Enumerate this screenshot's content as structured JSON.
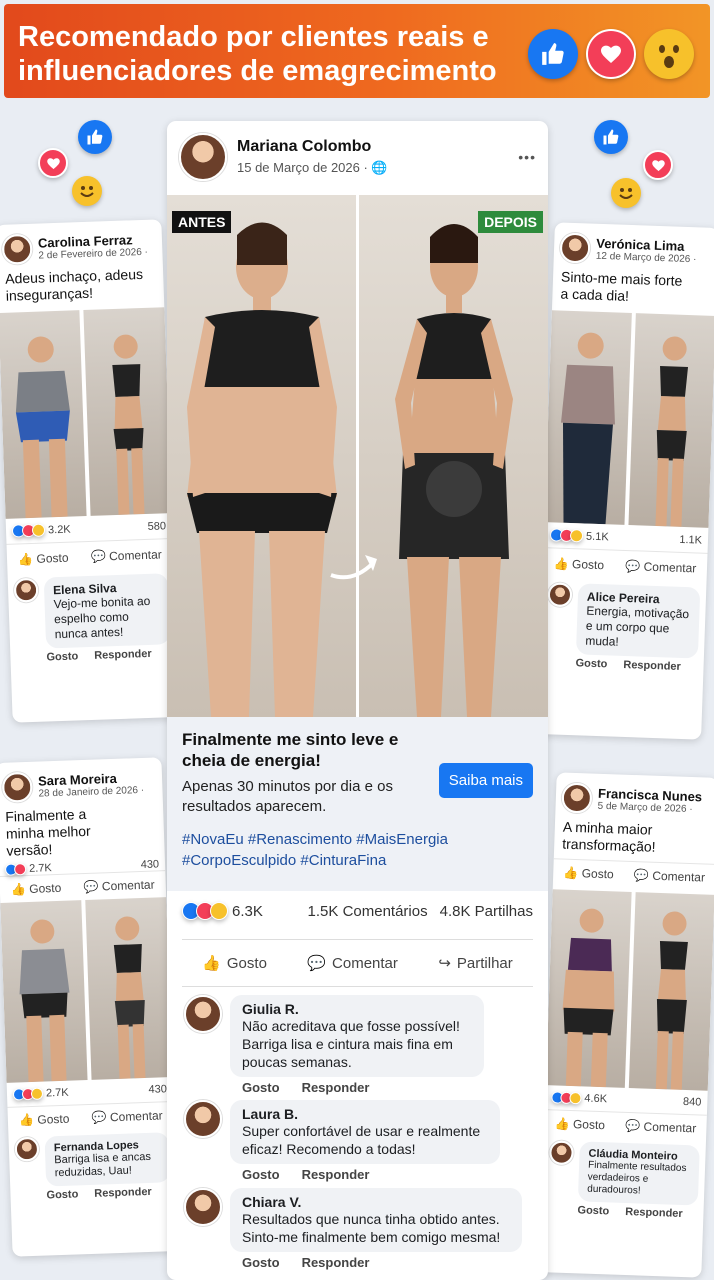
{
  "banner": {
    "title": "Recomendado por clientes reais e influenciadores de emagrecimento",
    "icons": [
      "like-icon",
      "heart-icon",
      "wow-icon"
    ]
  },
  "main_post": {
    "author": "Mariana Colombo",
    "date": "15 de Março de 2026 · ",
    "more": "•••",
    "before_label": "ANTES",
    "after_label": "DEPOIS",
    "headline": "Finalmente me sinto leve e cheia de energia!",
    "subtext": "Apenas 30 minutos por dia e os resultados aparecem.",
    "cta": "Saiba mais",
    "hashtags": "#NovaEu #Renascimento #MaisEnergia #CorpoEsculpido #CinturaFina",
    "reactions": "6.3K",
    "comments_count": "1.5K Comentários",
    "shares_count": "4.8K Partilhas",
    "actions": {
      "like": "Gosto",
      "comment": "Comentar",
      "share": "Partilhar"
    },
    "comments": [
      {
        "name": "Giulia R.",
        "text": "Não acreditava que fosse possível! Barriga lisa e cintura mais fina em poucas semanas.",
        "like": "Gosto",
        "reply": "Responder"
      },
      {
        "name": "Laura B.",
        "text": "Super confortável de usar e realmente eficaz! Recomendo a todas!",
        "like": "Gosto",
        "reply": "Responder"
      },
      {
        "name": "Chiara V.",
        "text": "Resultados que nunca tinha obtido antes. Sinto-me finalmente bem comigo mesma!",
        "like": "Gosto",
        "reply": "Responder"
      }
    ]
  },
  "side_posts": [
    {
      "author": "Carolina Ferraz",
      "date": "2 de Fevereiro de 2026 · ",
      "text": "Adeus inchaço, adeus inseguranças!",
      "reactions": "3.2K",
      "count": "580",
      "like": "Gosto",
      "comment": "Comentar",
      "comment_name": "Elena Silva",
      "comment_text": "Vejo-me bonita ao espelho como nunca antes!",
      "c_like": "Gosto",
      "c_reply": "Responder"
    },
    {
      "author": "Verónica Lima",
      "date": "12 de Março de 2026 · ",
      "text": "Sinto-me mais forte a cada dia!",
      "reactions": "5.1K",
      "count": "1.1K",
      "like": "Gosto",
      "comment": "Comentar",
      "comment_name": "Alice Pereira",
      "comment_text": "Energia, motivação e um corpo que muda!",
      "c_like": "Gosto",
      "c_reply": "Responder"
    },
    {
      "author": "Sara Moreira",
      "date": "28 de Janeiro de 2026 · ",
      "text": "Finalmente a minha melhor versão!",
      "reactions": "2.7K",
      "count": "430",
      "like": "Gosto",
      "comment": "Comentar",
      "reactions2": "2.7K",
      "count2": "430",
      "comment_name": "Fernanda Lopes",
      "comment_text": "Barriga lisa e ancas reduzidas, Uau!",
      "c_like": "Gosto",
      "c_reply": "Responder"
    },
    {
      "author": "Francisca Nunes",
      "date": "5 de Março de 2026 · ",
      "text": "A minha maior transformação!",
      "like": "Gosto",
      "comment": "Comentar",
      "reactions": "4.6K",
      "count": "840",
      "comment_name": "Cláudia Monteiro",
      "comment_text": "Finalmente resultados verdadeiros e duradouros!",
      "c_like": "Gosto",
      "c_reply": "Responder"
    }
  ],
  "colors": {
    "banner": "#e9541e",
    "like": "#1877f2",
    "heart": "#f33e58",
    "wow": "#f7c12b",
    "cta": "#1877f2"
  }
}
